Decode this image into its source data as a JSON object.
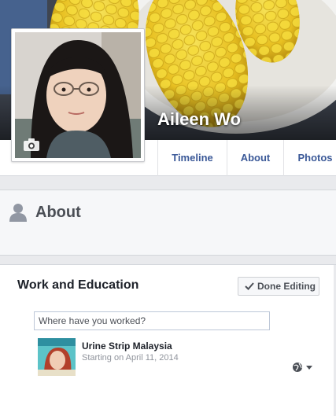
{
  "profile": {
    "name": "Aileen Wo"
  },
  "nav": {
    "tabs": [
      "Timeline",
      "About",
      "Photos"
    ]
  },
  "about": {
    "title": "About"
  },
  "work_education": {
    "title": "Work and Education",
    "done_button": "Done Editing",
    "input_placeholder": "Where have you worked?",
    "job": {
      "name": "Urine Strip Malaysia",
      "dates": "Starting on April 11, 2014"
    }
  },
  "colors": {
    "link": "#3b5998",
    "heading": "#4b4f56"
  },
  "icons": {
    "camera": "camera-icon",
    "about": "person-icon",
    "check": "check-icon",
    "privacy": "globe-icon"
  }
}
